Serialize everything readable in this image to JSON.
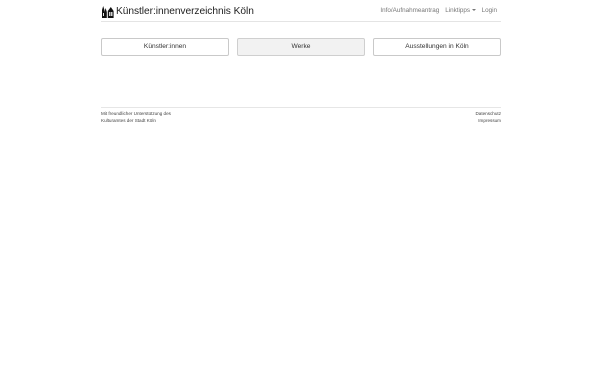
{
  "navbar": {
    "brand_logo": "cologne-cathedral-logo-icon",
    "brand_text": "Künstler:innenverzeichnis Köln",
    "links": {
      "info": "Info/Aufnahmeantrag",
      "linktipps": "Linktipps",
      "login": "Login"
    }
  },
  "main": {
    "buttons": {
      "artists": "Künstler:innen",
      "works": "Werke",
      "exhibitions": "Ausstellungen in Köln"
    },
    "active_button": "works"
  },
  "footer": {
    "left_line1": "Mit freundlicher Unterstützung des",
    "left_line2": "Kulturamtes der Stadt Köln",
    "datenschutz": "Datenschutz",
    "impressum": "Impressum"
  },
  "colors": {
    "text": "#333333",
    "nav_link": "#777777",
    "active_button_bg": "#f2f2f2",
    "border": "#c9c9c9"
  }
}
